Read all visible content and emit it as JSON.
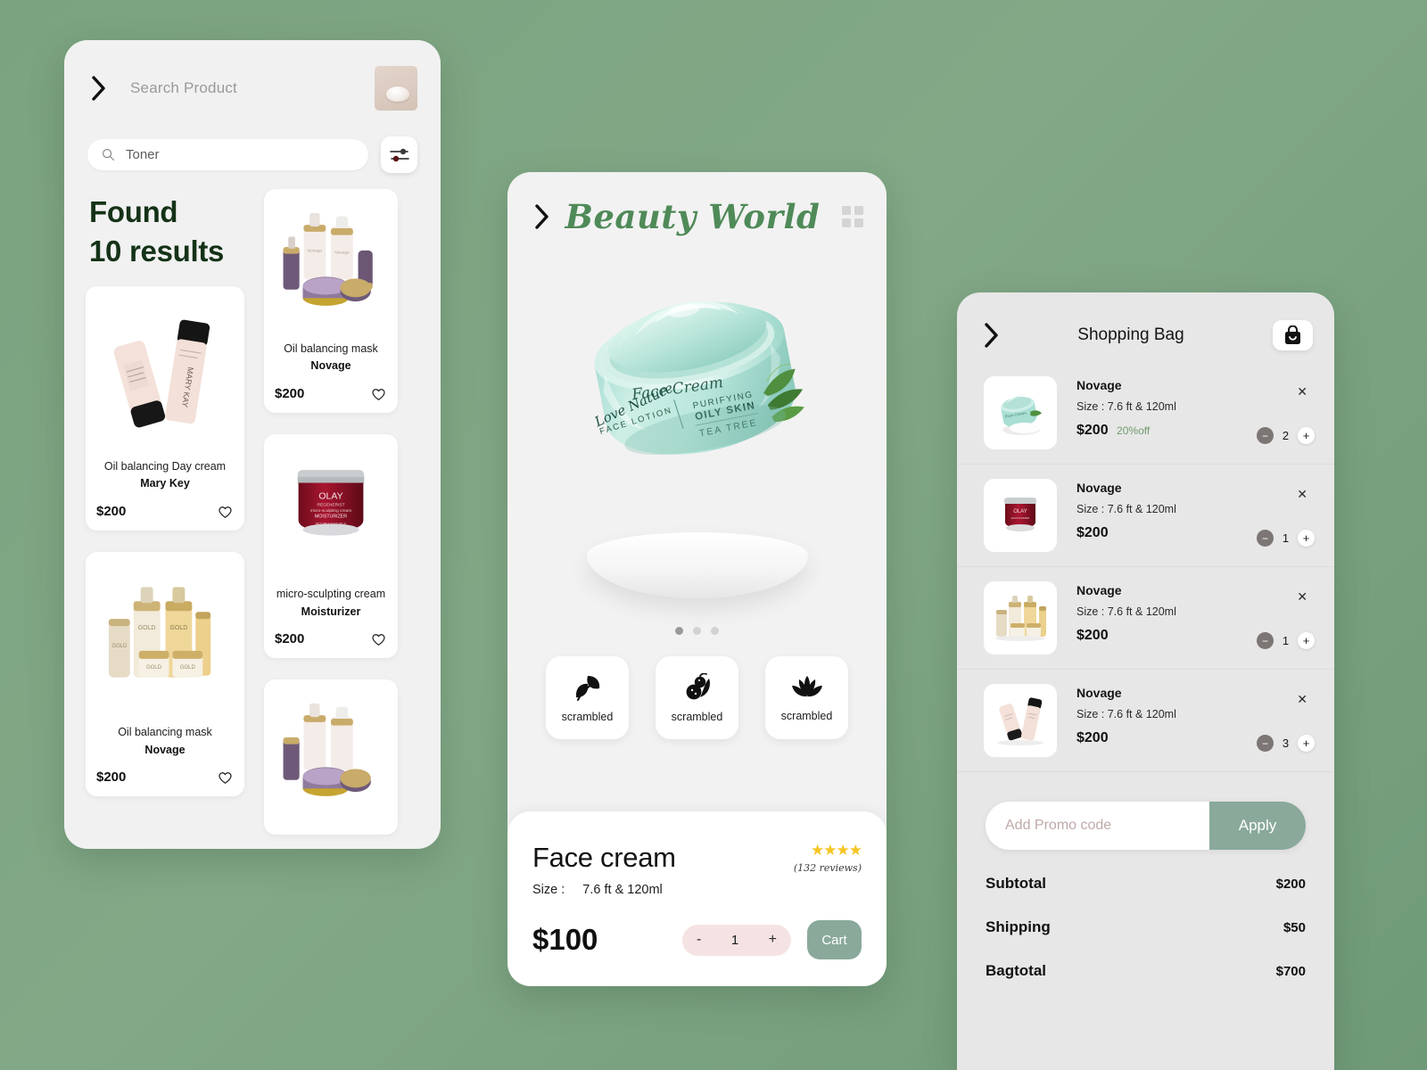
{
  "background_color": "#7ba37f",
  "accent_green": "#8aa99a",
  "title_green": "#143217",
  "brand_green": "#4f8a58",
  "search_panel": {
    "back_icon": "chevron-right-icon",
    "search_label": "Search Product",
    "avatar": "product-thumbnail",
    "search": {
      "value": "Toner",
      "placeholder": "Toner",
      "icon": "search-icon"
    },
    "filter_icon": "filter-sliders-icon",
    "results_heading_line1": "Found",
    "results_heading_line2": "10 results",
    "products": [
      {
        "name": "Oil balancing Day cream",
        "brand": "Mary Key",
        "price": "$200",
        "fav_icon": "heart-icon"
      },
      {
        "name": "Oil balancing mask",
        "brand": "Novage",
        "price": "$200",
        "fav_icon": "heart-icon"
      },
      {
        "name": "Oil balancing mask",
        "brand": "Novage",
        "price": "$200",
        "fav_icon": "heart-icon"
      },
      {
        "name": "micro-sculpting cream",
        "brand": "Moisturizer",
        "price": "$200",
        "fav_icon": "heart-icon"
      }
    ]
  },
  "detail_panel": {
    "back_icon": "chevron-right-icon",
    "brand": "Beauty World",
    "grid_icon": "grid-menu-icon",
    "jar_label": {
      "script": "Love Nature",
      "lotion": "FACE LOTION",
      "cream": "Face Cream",
      "line1": "PURIFYING",
      "line2": "OILY SKIN",
      "line3": "TEA TREE"
    },
    "carousel_dots": 3,
    "carousel_active": 0,
    "features": [
      {
        "icon": "leaf-icon",
        "label": "scrambled"
      },
      {
        "icon": "fruit-icon",
        "label": "scrambled"
      },
      {
        "icon": "lotus-icon",
        "label": "scrambled"
      }
    ],
    "product_title": "Face cream",
    "size_label": "Size :",
    "size_value": "7.6 ft & 120ml",
    "stars": "★★★★",
    "star_count": 4,
    "reviews": "(132 reviews)",
    "price": "$100",
    "qty_minus": "-",
    "qty_value": "1",
    "qty_plus": "+",
    "cart_label": "Cart"
  },
  "cart_panel": {
    "back_icon": "chevron-right-icon",
    "title": "Shopping Bag",
    "bag_icon": "shopping-bag-icon",
    "items": [
      {
        "name": "Novage",
        "size": "Size :  7.6 ft  & 120ml",
        "price": "$200",
        "discount": "20%off",
        "qty": "2",
        "remove_icon": "close-icon",
        "thumb": "mint-jar"
      },
      {
        "name": "Novage",
        "size": "Size :  7.6 ft  & 120ml",
        "price": "$200",
        "discount": "",
        "qty": "1",
        "remove_icon": "close-icon",
        "thumb": "red-jar"
      },
      {
        "name": "Novage",
        "size": "Size :  7.6 ft  & 120ml",
        "price": "$200",
        "discount": "",
        "qty": "1",
        "remove_icon": "close-icon",
        "thumb": "gold-set"
      },
      {
        "name": "Novage",
        "size": "Size :  7.6 ft  & 120ml",
        "price": "$200",
        "discount": "",
        "qty": "3",
        "remove_icon": "close-icon",
        "thumb": "cream-pair"
      }
    ],
    "promo_placeholder": "Add Promo code",
    "apply_label": "Apply",
    "totals": [
      {
        "label": "Subtotal",
        "value": "$200"
      },
      {
        "label": "Shipping",
        "value": "$50"
      },
      {
        "label": "Bagtotal",
        "value": "$700"
      }
    ]
  }
}
